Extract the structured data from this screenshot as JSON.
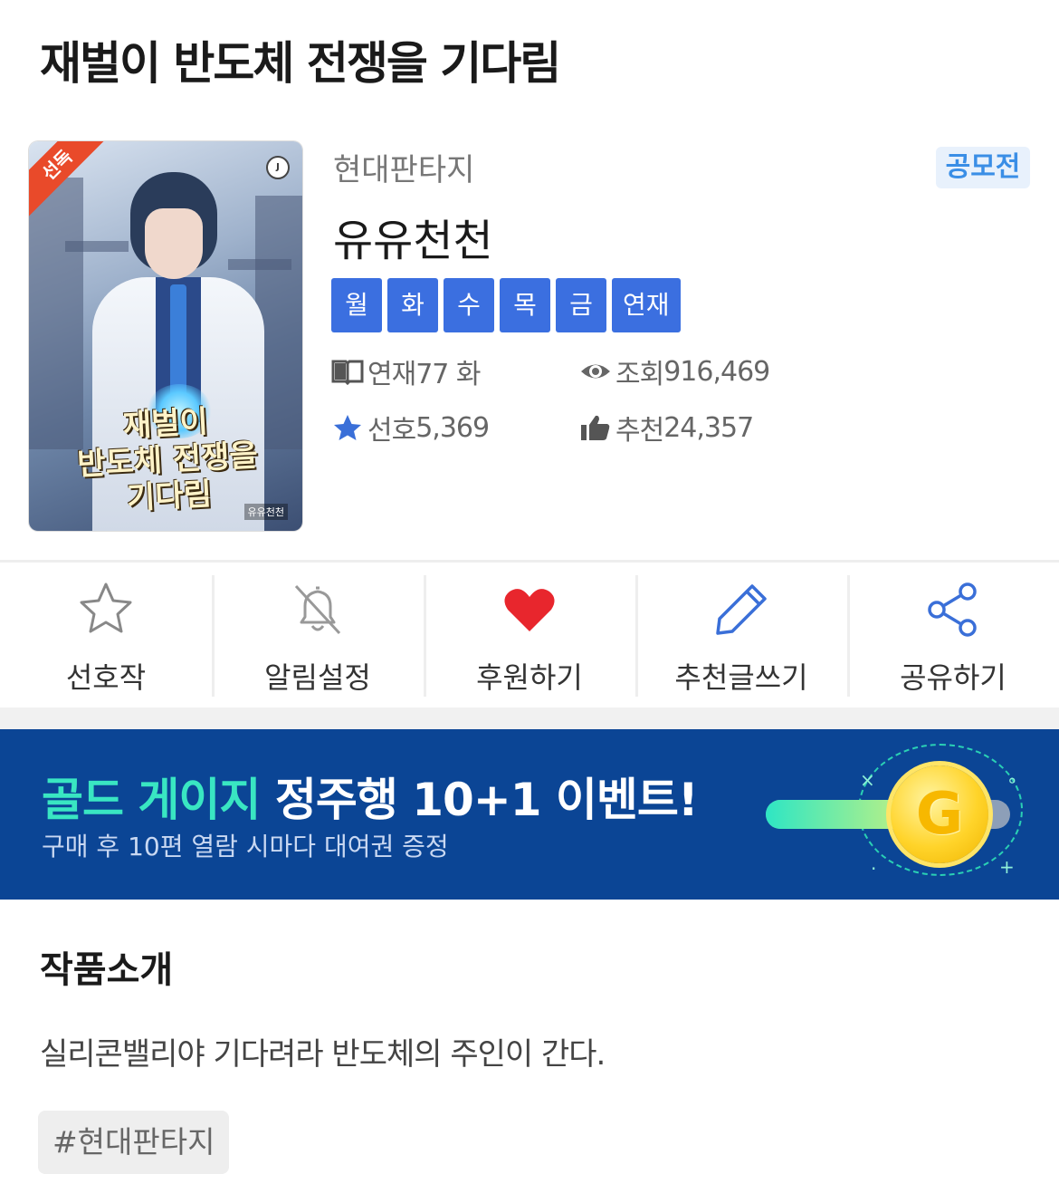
{
  "title": "재벌이 반도체 전쟁을 기다림",
  "cover": {
    "badge": "선독",
    "publisher_mark": "J",
    "title_line1": "재벌이",
    "title_line2": "반도체 전쟁을",
    "title_line3": "기다림",
    "author_caption": "유유천천"
  },
  "genre": "현대판타지",
  "contest_badge": "공모전",
  "author": "유유천천",
  "schedule": [
    "월",
    "화",
    "수",
    "목",
    "금",
    "연재"
  ],
  "stats": {
    "episodes_label": "연재",
    "episodes_value": "77 화",
    "views_label": "조회",
    "views_value": "916,469",
    "favorites_label": "선호",
    "favorites_value": "5,369",
    "recommends_label": "추천",
    "recommends_value": "24,357"
  },
  "actions": [
    {
      "label": "선호작",
      "icon": "star-outline-icon"
    },
    {
      "label": "알림설정",
      "icon": "bell-off-icon"
    },
    {
      "label": "후원하기",
      "icon": "heart-icon"
    },
    {
      "label": "추천글쓰기",
      "icon": "pencil-icon"
    },
    {
      "label": "공유하기",
      "icon": "share-icon"
    }
  ],
  "banner": {
    "headline_accent": "골드 게이지",
    "headline_main": "정주행 10+1 이벤트!",
    "subtext": "구매 후 10편 열람 시마다 대여권 증정",
    "coin_letter": "G",
    "gauge_fraction": 0.67
  },
  "intro": {
    "heading": "작품소개",
    "body": "실리콘밸리야 기다려라 반도체의 주인이 간다.",
    "tag": "#현대판타지"
  },
  "colors": {
    "day_chip": "#3b6fe0",
    "contest_text": "#3a8ee6",
    "banner_bg": "#0b4595",
    "banner_accent": "#39e6c2",
    "heart": "#e8262d",
    "icon_blue": "#3a6fd8"
  }
}
